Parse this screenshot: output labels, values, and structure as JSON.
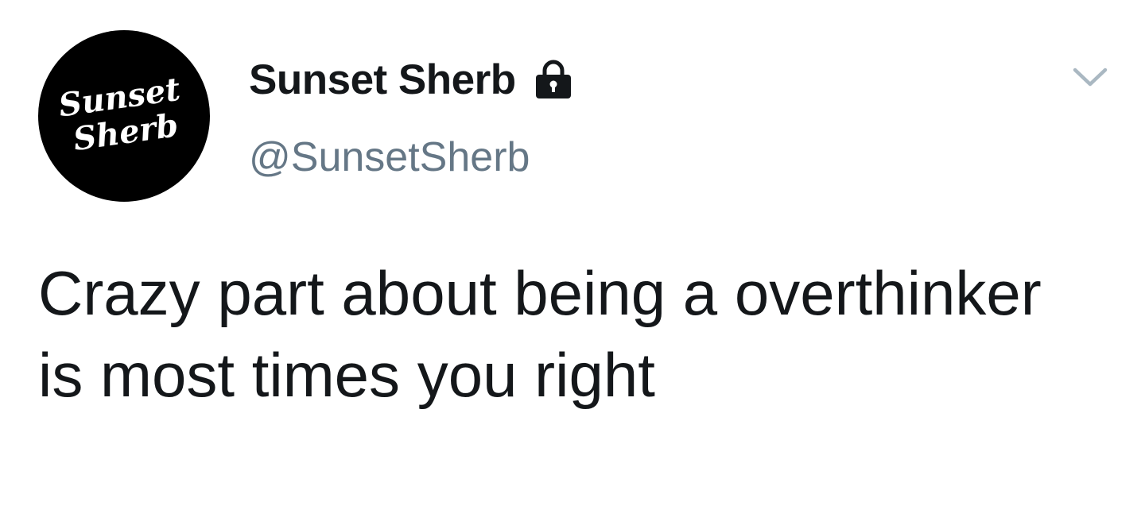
{
  "tweet": {
    "author": {
      "avatar_text_line1": "Sunset",
      "avatar_text_line2": "Sherb",
      "display_name": "Sunset Sherb",
      "handle": "@SunsetSherb",
      "protected_icon": "lock-icon"
    },
    "menu_icon": "chevron-down-icon",
    "text": "Crazy part about being a overthinker is most times you right"
  },
  "colors": {
    "text_primary": "#14171a",
    "text_secondary": "#657786",
    "avatar_bg": "#000000",
    "chevron": "#aab8c2"
  }
}
